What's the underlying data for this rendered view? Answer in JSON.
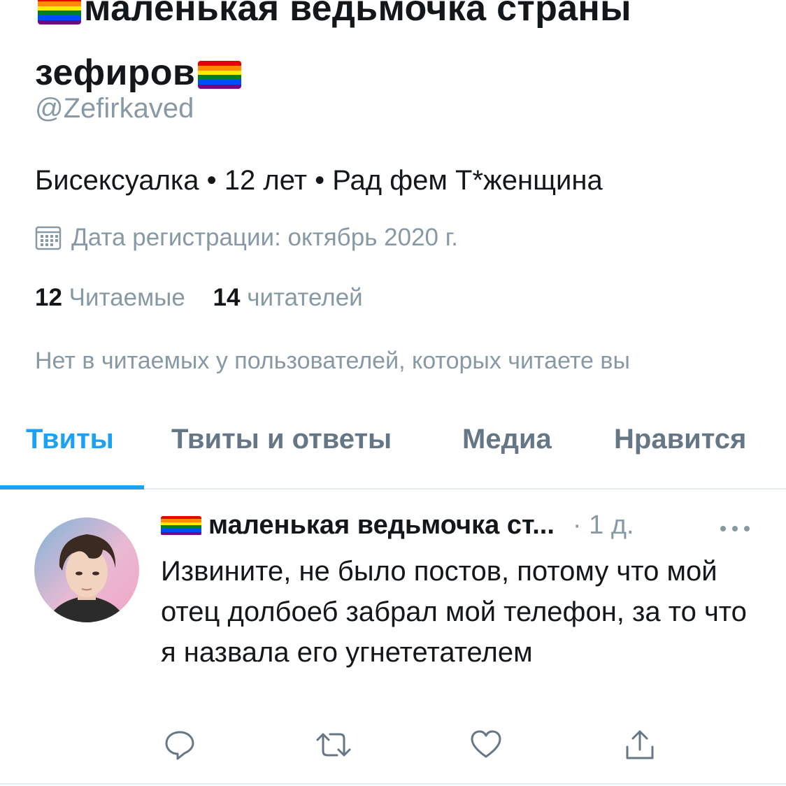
{
  "colors": {
    "accent": "#1da1f2",
    "secondary_text": "#8899a6",
    "primary_text": "#14171a",
    "divider": "#e6ecf0",
    "pride_flag": [
      "#e40303",
      "#ff8c00",
      "#ffed00",
      "#008026",
      "#004dff",
      "#750787"
    ]
  },
  "profile": {
    "display_name": "маленькая ведьмочка страны зефиров",
    "handle": "@Zefirkaved",
    "bio": "Бисексуалка • 12 лет • Рад фем Т*женщина",
    "joined": "Дата регистрации: октябрь 2020 г.",
    "following_count": "12",
    "following_label": "Читаемые",
    "followers_count": "14",
    "followers_label": "читателей",
    "followed_by_note": "Нет в читаемых у пользователей, которых читаете вы"
  },
  "tabs": [
    {
      "label": "Твиты",
      "active": true
    },
    {
      "label": "Твиты и ответы",
      "active": false
    },
    {
      "label": "Медиа",
      "active": false
    },
    {
      "label": "Нравится",
      "active": false
    }
  ],
  "tweet": {
    "author": "маленькая ведьмочка ст...",
    "time": "· 1 д.",
    "text": "Извините, не было постов, потому что мой отец долбоеб забрал мой телефон, за то что я назвала его угнететателем"
  },
  "icons": {
    "flag": "rainbow-flag-icon",
    "calendar": "calendar-icon",
    "more": "more-icon",
    "reply": "reply-icon",
    "retweet": "retweet-icon",
    "like": "heart-icon",
    "share": "share-icon"
  }
}
